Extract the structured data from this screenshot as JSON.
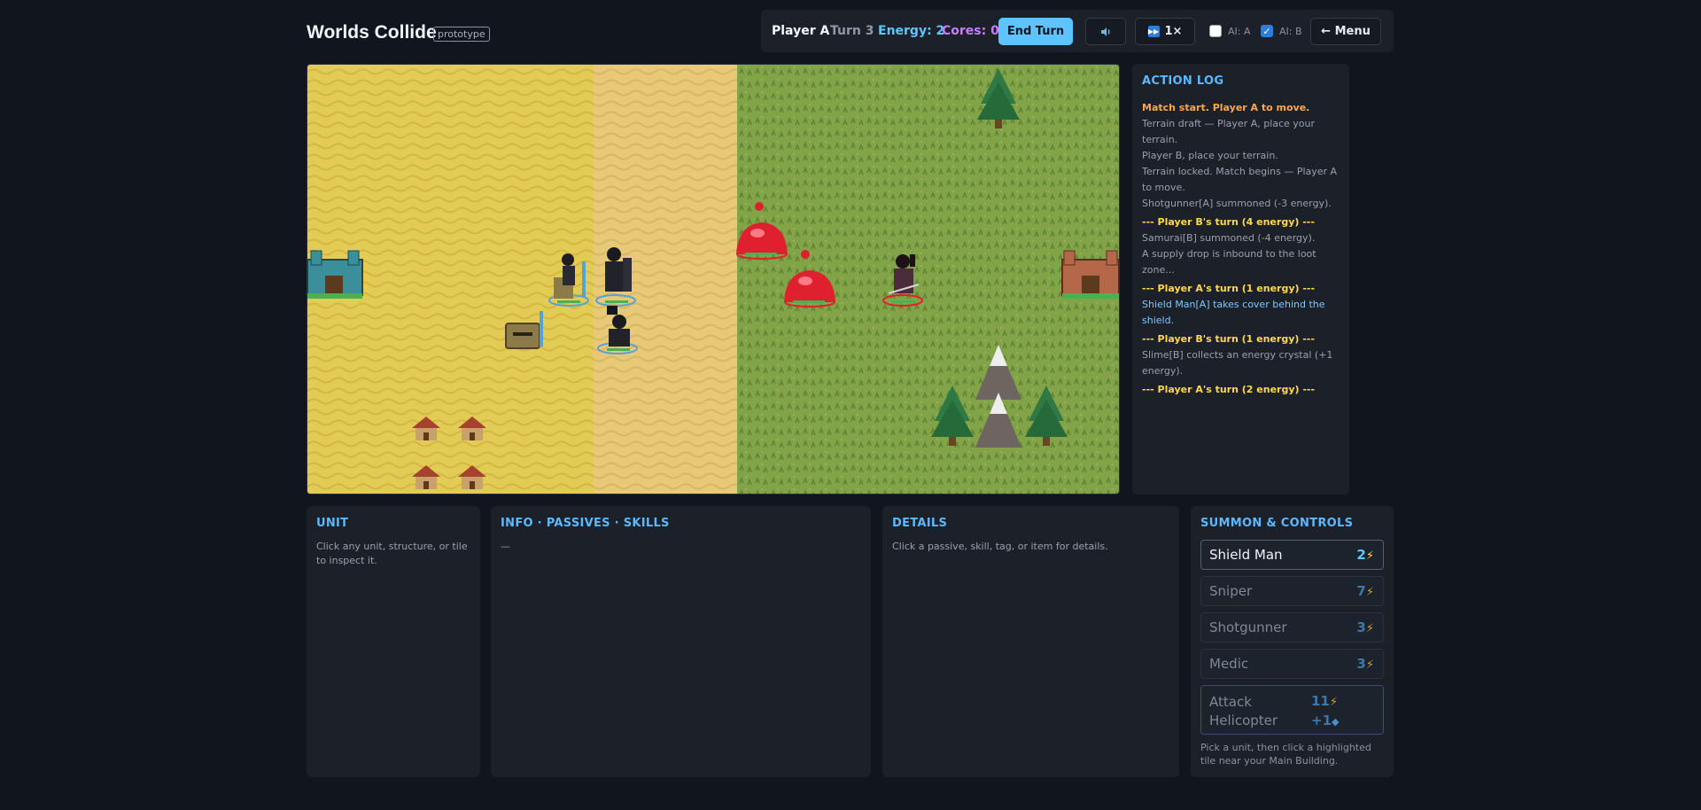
{
  "header": {
    "title": "Worlds Collide",
    "badge": "prototype",
    "player": "Player A",
    "turn": "Turn 3",
    "energy": "Energy: 2",
    "cores": "Cores: 0",
    "end_turn": "End Turn",
    "sound_icon": "speaker-icon",
    "speed": "1×",
    "ai_a_label": "AI: A",
    "ai_a_checked": false,
    "ai_b_label": "AI: B",
    "ai_b_checked": true,
    "menu": "← Menu"
  },
  "board": {
    "terrain_left": "desert",
    "terrain_right": "grassland",
    "colors": {
      "sand": "#e4cf58",
      "grass": "#7d9e44"
    }
  },
  "log": {
    "title": "ACTION LOG",
    "entries": [
      {
        "kind": "start",
        "text": "Match start. Player A to move."
      },
      {
        "kind": "info",
        "text": "Terrain draft — Player A, place your terrain."
      },
      {
        "kind": "info",
        "text": "Player B, place your terrain."
      },
      {
        "kind": "info",
        "text": "Terrain locked. Match begins — Player A to move."
      },
      {
        "kind": "info",
        "text": "Shotgunner[A] summoned (-3 energy)."
      },
      {
        "kind": "turn",
        "text": "--- Player B's turn (4 energy) ---"
      },
      {
        "kind": "info",
        "text": "Samurai[B] summoned (-4 energy)."
      },
      {
        "kind": "info",
        "text": "A supply drop is inbound to the loot zone..."
      },
      {
        "kind": "turn",
        "text": "--- Player A's turn (1 energy) ---"
      },
      {
        "kind": "cover",
        "text": "Shield Man[A] takes cover behind the shield."
      },
      {
        "kind": "turn",
        "text": "--- Player B's turn (1 energy) ---"
      },
      {
        "kind": "info",
        "text": "Slime[B] collects an energy crystal (+1 energy)."
      },
      {
        "kind": "turn",
        "text": "--- Player A's turn (2 energy) ---"
      }
    ]
  },
  "unit": {
    "title": "UNIT",
    "hint": "Click any unit, structure, or tile to inspect it."
  },
  "info": {
    "title": "INFO · PASSIVES · SKILLS",
    "value": "—"
  },
  "details": {
    "title": "DETAILS",
    "hint": "Click a passive, skill, tag, or item for details."
  },
  "summon": {
    "title": "SUMMON & CONTROLS",
    "items": [
      {
        "name": "Shield Man",
        "cost": "2",
        "selected": true
      },
      {
        "name": "Sniper",
        "cost": "7"
      },
      {
        "name": "Shotgunner",
        "cost": "3"
      },
      {
        "name": "Medic",
        "cost": "3"
      }
    ],
    "heli": {
      "name_line1": "Attack",
      "name_line2": "Helicopter",
      "cost": "11",
      "cores": "+1"
    },
    "hint": "Pick a unit, then click a highlighted tile near your Main Building."
  }
}
